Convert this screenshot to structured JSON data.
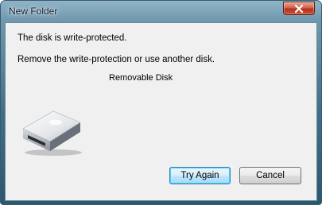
{
  "window": {
    "title": "New Folder",
    "close_icon": "close-icon"
  },
  "dialog": {
    "message_primary": "The disk is write-protected.",
    "message_secondary": "Remove the write-protection or use another disk.",
    "device_label": "Removable Disk",
    "device_icon": "removable-disk-icon"
  },
  "buttons": {
    "try_again_label": "Try Again",
    "cancel_label": "Cancel"
  },
  "colors": {
    "frame": "#3f6f88",
    "client": "#f0f0f0",
    "close_button": "#c9502f",
    "default_button_border": "#3c7fb1"
  }
}
